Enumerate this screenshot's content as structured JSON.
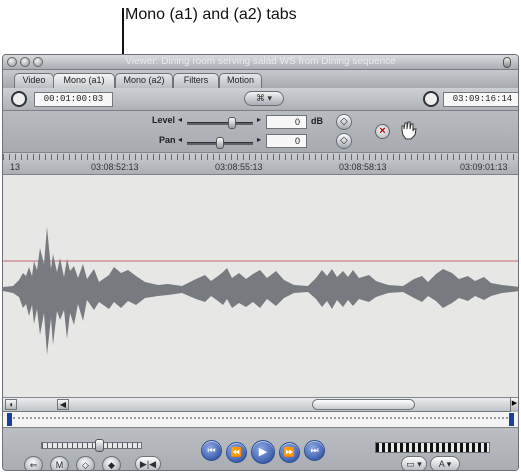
{
  "callout": {
    "text": "Mono (a1) and (a2) tabs"
  },
  "window": {
    "title": "Viewer: Dining room serving salad WS from Dining sequence"
  },
  "tabs": [
    {
      "label": "Video",
      "active": false
    },
    {
      "label": "Mono (a1)",
      "active": true
    },
    {
      "label": "Mono (a2)",
      "active": false
    },
    {
      "label": "Filters",
      "active": false
    },
    {
      "label": "Motion",
      "active": false
    }
  ],
  "toolbar": {
    "left_timecode": "00:01:00:03",
    "right_timecode": "03:09:16:14",
    "center_popup": "⌘ ▾"
  },
  "controls": {
    "level_label": "Level",
    "level_value": "0",
    "level_unit": "dB",
    "pan_label": "Pan",
    "pan_value": "0"
  },
  "ruler": {
    "labels": [
      "13",
      "03:08:52:13",
      "03:08:55:13",
      "03:08:58:13",
      "03:09:01:13"
    ]
  },
  "playback": {
    "buttons": [
      "⏮",
      "⏪",
      "▶",
      "⏩",
      "⏭"
    ]
  },
  "bottom_tools": {
    "left_buttons": [
      "⇐",
      "M",
      "◇",
      "◆",
      "▶|◀"
    ],
    "right_menu_1": "▭ ▾",
    "right_menu_2": "A ▾"
  }
}
